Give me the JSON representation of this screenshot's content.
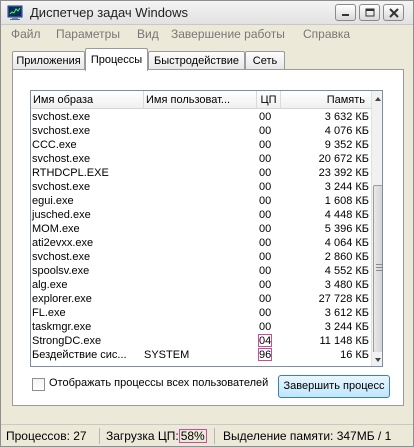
{
  "window": {
    "title": "Диспетчер задач Windows"
  },
  "menu": [
    "Файл",
    "Параметры",
    "Вид",
    "Завершение работы",
    "Справка"
  ],
  "tabs": [
    "Приложения",
    "Процессы",
    "Быстродействие",
    "Сеть"
  ],
  "active_tab": "Процессы",
  "columns": {
    "image": "Имя образа",
    "user": "Имя пользоват...",
    "cpu": "ЦП",
    "memory": "Память"
  },
  "processes": [
    {
      "name": "svchost.exe",
      "user": "",
      "cpu": "00",
      "mem": "3 632 КБ"
    },
    {
      "name": "svchost.exe",
      "user": "",
      "cpu": "00",
      "mem": "4 076 КБ"
    },
    {
      "name": "CCC.exe",
      "user": "",
      "cpu": "00",
      "mem": "9 352 КБ"
    },
    {
      "name": "svchost.exe",
      "user": "",
      "cpu": "00",
      "mem": "20 672 КБ"
    },
    {
      "name": "RTHDCPL.EXE",
      "user": "",
      "cpu": "00",
      "mem": "23 392 КБ"
    },
    {
      "name": "svchost.exe",
      "user": "",
      "cpu": "00",
      "mem": "3 244 КБ"
    },
    {
      "name": "egui.exe",
      "user": "",
      "cpu": "00",
      "mem": "1 608 КБ"
    },
    {
      "name": "jusched.exe",
      "user": "",
      "cpu": "00",
      "mem": "4 448 КБ"
    },
    {
      "name": "MOM.exe",
      "user": "",
      "cpu": "00",
      "mem": "5 396 КБ"
    },
    {
      "name": "ati2evxx.exe",
      "user": "",
      "cpu": "00",
      "mem": "4 064 КБ"
    },
    {
      "name": "svchost.exe",
      "user": "",
      "cpu": "00",
      "mem": "2 860 КБ"
    },
    {
      "name": "spoolsv.exe",
      "user": "",
      "cpu": "00",
      "mem": "4 552 КБ"
    },
    {
      "name": "alg.exe",
      "user": "",
      "cpu": "00",
      "mem": "3 480 КБ"
    },
    {
      "name": "explorer.exe",
      "user": "",
      "cpu": "00",
      "mem": "27 728 КБ"
    },
    {
      "name": "FL.exe",
      "user": "",
      "cpu": "00",
      "mem": "3 612 КБ"
    },
    {
      "name": "taskmgr.exe",
      "user": "",
      "cpu": "00",
      "mem": "3 244 КБ"
    },
    {
      "name": "StrongDC.exe",
      "user": "",
      "cpu": "04",
      "mem": "11 148 КБ"
    },
    {
      "name": "Бездействие сис...",
      "user": "SYSTEM",
      "cpu": "96",
      "mem": "16 КБ"
    }
  ],
  "show_all_users_label": "Отображать процессы всех пользователей",
  "end_process_label": "Завершить процесс",
  "status": {
    "processes": "Процессов: 27",
    "cpu_label": "Загрузка ЦП:",
    "cpu_value": "58%",
    "memory": "Выделение памяти: 347МБ / 1"
  },
  "icons": [
    "taskmanager-icon",
    "minimize-icon",
    "maximize-icon",
    "close-icon",
    "scroll-up-icon",
    "scroll-down-icon"
  ]
}
